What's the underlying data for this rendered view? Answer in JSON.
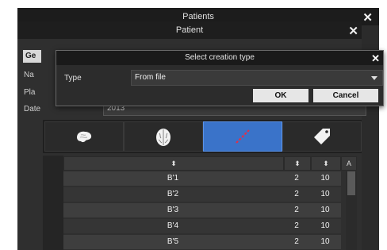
{
  "outer_window": {
    "title": "Patients",
    "close_glyph": "✕"
  },
  "inner_window": {
    "title": "Patient",
    "close_glyph": "✕"
  },
  "background_form": {
    "tab_label": "Ge",
    "name_label": "Na",
    "place_label": "Pla",
    "date_label": "Date",
    "date_value": "2013"
  },
  "side_buttons": {
    "plus": "+",
    "minus": "-"
  },
  "toolbar_icons": [
    {
      "name": "brain-side-icon",
      "selected": false
    },
    {
      "name": "brain-top-icon",
      "selected": false
    },
    {
      "name": "electrode-icon",
      "selected": true
    },
    {
      "name": "tag-icon",
      "selected": false
    }
  ],
  "table": {
    "sort_glyph": "⬍",
    "extra_header": "A",
    "rows": [
      {
        "name": "B'1",
        "col2": "2",
        "col3": "10"
      },
      {
        "name": "B'2",
        "col2": "2",
        "col3": "10"
      },
      {
        "name": "B'3",
        "col2": "2",
        "col3": "10"
      },
      {
        "name": "B'4",
        "col2": "2",
        "col3": "10"
      },
      {
        "name": "B'5",
        "col2": "2",
        "col3": "10"
      }
    ]
  },
  "dialog": {
    "title": "Select creation type",
    "close_glyph": "✕",
    "type_label": "Type",
    "type_value": "From file",
    "ok_label": "OK",
    "cancel_label": "Cancel"
  },
  "colors": {
    "accent": "#3a73c9",
    "electrode_icon": "#e0304a"
  }
}
